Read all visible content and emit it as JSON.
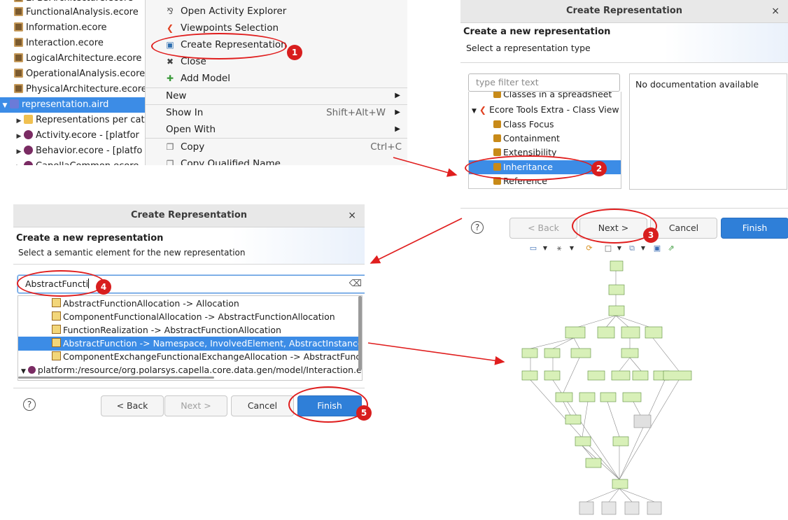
{
  "tree": {
    "items": [
      {
        "label": "FunctionalAnalysis.ecore",
        "icon": "ecore-icon"
      },
      {
        "label": "Information.ecore",
        "icon": "ecore-icon"
      },
      {
        "label": "Interaction.ecore",
        "icon": "ecore-icon"
      },
      {
        "label": "LogicalArchitecture.ecore",
        "icon": "ecore-icon"
      },
      {
        "label": "OperationalAnalysis.ecore",
        "icon": "ecore-icon"
      },
      {
        "label": "PhysicalArchitecture.ecore",
        "icon": "ecore-icon"
      },
      {
        "label": "representation.aird",
        "icon": "aird-icon"
      },
      {
        "label": "Representations per cat",
        "icon": "folder-icon"
      },
      {
        "label": "Activity.ecore - [platfor",
        "icon": "ecore-model-icon"
      },
      {
        "label": "Behavior.ecore - [platfo",
        "icon": "ecore-model-icon"
      }
    ]
  },
  "context_menu": {
    "items": [
      {
        "label": "Open Activity Explorer",
        "icon": "activity-explorer-icon"
      },
      {
        "label": "Viewpoints Selection",
        "icon": "viewpoints-icon"
      },
      {
        "label": "Create Representation",
        "icon": "create-representation-icon"
      },
      {
        "label": "Close",
        "icon": "close-icon"
      },
      {
        "label": "Add Model",
        "icon": "add-model-icon"
      },
      {
        "label": "New",
        "submenu": true
      },
      {
        "label": "Show In",
        "shortcut": "Shift+Alt+W",
        "submenu": true
      },
      {
        "label": "Open With",
        "submenu": true
      },
      {
        "label": "Copy",
        "shortcut": "Ctrl+C",
        "icon": "copy-icon"
      },
      {
        "label": "Copy Qualified Name",
        "icon": "copy-icon"
      }
    ]
  },
  "dialog1": {
    "title": "Create Representation",
    "close": "×",
    "heading": "Create a new representation",
    "subheading": "Select a representation type",
    "filter_placeholder": "type filter text",
    "list": [
      {
        "label": "Classes in a spreadsheet",
        "level": 2
      },
      {
        "label": "Ecore Tools Extra - Class View",
        "level": 1
      },
      {
        "label": "Class Focus",
        "level": 2
      },
      {
        "label": "Containment",
        "level": 2
      },
      {
        "label": "Extensibility",
        "level": 2
      },
      {
        "label": "Inheritance",
        "level": 2,
        "selected": true
      },
      {
        "label": "Reference",
        "level": 2
      }
    ],
    "documentation": "No documentation available",
    "buttons": {
      "back": "< Back",
      "next": "Next >",
      "cancel": "Cancel",
      "finish": "Finish"
    },
    "help": "?"
  },
  "dialog2": {
    "title": "Create Representation",
    "close": "×",
    "heading": "Create a new representation",
    "subheading": "Select a semantic element for the new representation",
    "filter_value": "AbstractFuncti",
    "clear": "⌫",
    "list": [
      "AbstractFunctionAllocation -> Allocation",
      "ComponentFunctionalAllocation -> AbstractFunctionAllocation",
      "FunctionRealization -> AbstractFunctionAllocation",
      "AbstractFunction -> Namespace, InvolvedElement, AbstractInstance, Abstract",
      "ComponentExchangeFunctionalExchangeAllocation -> AbstractFunctionAlloca",
      "platform:/resource/org.polarsys.capella.core.data.gen/model/Interaction.ecore"
    ],
    "selected_index": 3,
    "buttons": {
      "back": "< Back",
      "next": "Next >",
      "cancel": "Cancel",
      "finish": "Finish"
    },
    "help": "?"
  },
  "badges": [
    "1",
    "2",
    "3",
    "4",
    "5"
  ],
  "colors": {
    "accent": "#e01e1e",
    "selection": "#3c8ce6",
    "primary_button": "#2f7fd8",
    "node_fill": "#d8f0b8"
  }
}
